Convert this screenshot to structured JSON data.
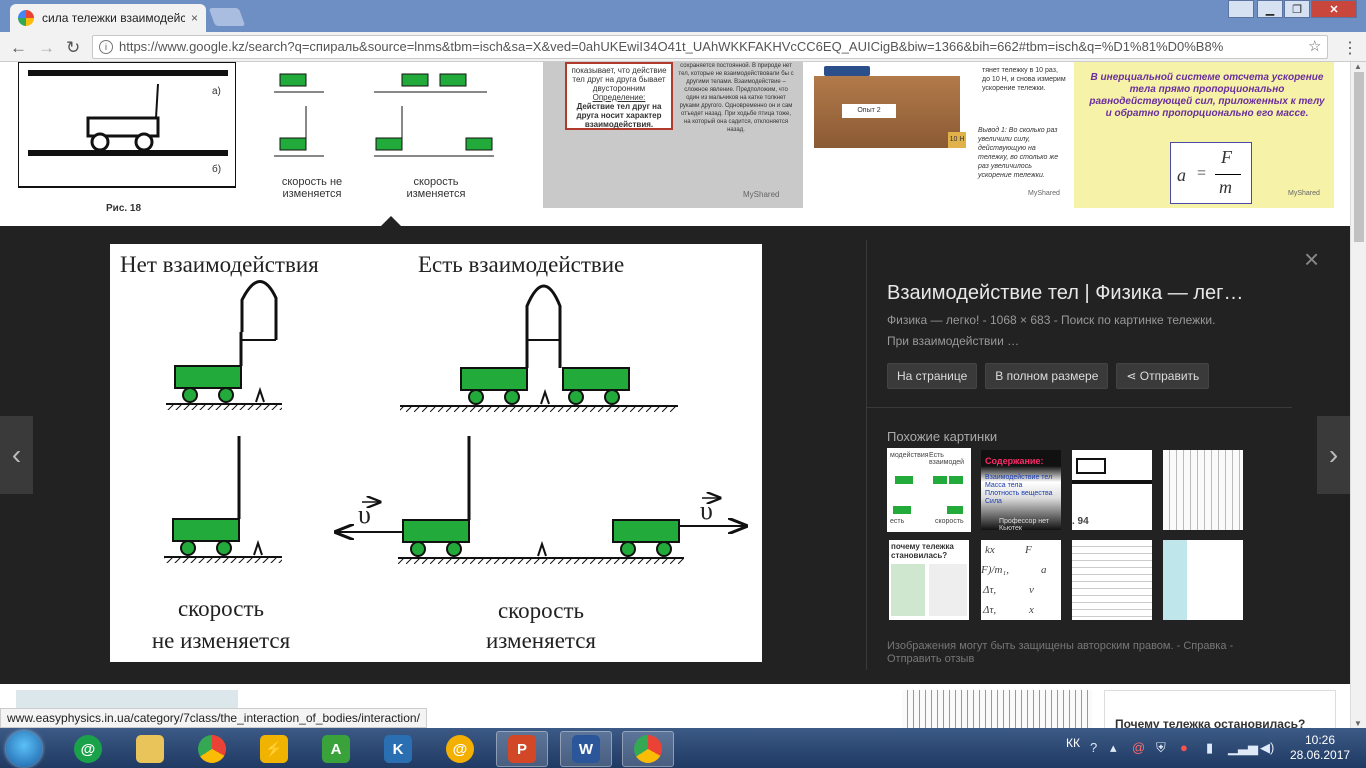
{
  "browser": {
    "tab_title": "сила тележки взаимодейс",
    "tab_close": "×",
    "url": "https://www.google.kz/search?q=спираль&source=lnms&tbm=isch&sa=X&ved=0ahUKEwiI34O41t_UAhWKKFAKHVcCC6EQ_AUICigB&biw=1366&bih=662#tbm=isch&q=%D1%81%D0%B8%",
    "status_url": "www.easyphysics.in.ua/category/7class/the_interaction_of_bodies/interaction/"
  },
  "thumbs_top": {
    "fig_label_a": "а)",
    "fig_label_b": "б)",
    "fig_caption": "Рис. 18",
    "t2_left_caption": "скорость не изменяется",
    "t2_right_caption": "скорость изменяется",
    "t3_text_1": "показывает, что действие тел друг на друга бывает двусторонним",
    "t3_definition": "Определение:",
    "t3_text_2": "Действие тел друг на друга носит характер взаимодействия.",
    "t3_right_1": "сохраняется постоянной. В природе нет тел, которые не взаимодействовали бы с другими телами.",
    "t3_right_2": "Взаимодействие – сложное явление. Предположим, что один из мальчиков на катке толкнет руками другого. Одновременно он и сам отъедет назад.",
    "t3_right_3": "При ходьбе птица тоже, на который она садится, отклоняется назад.",
    "watermark": "MyShared",
    "t4_box": "Опыт 2",
    "t4_weight": "10 Н",
    "t4_text": "тянет тележку в 10 раз, до 10 Н, и снова измерим ускорение тележки.",
    "t4_conclusion": "Вывод 1: Во сколько раз увеличили силу, действующую на тележку, во столько же раз увеличилось ускорение тележки.",
    "t5_text": "В инерциальной системе отсчета ускорение тела прямо пропорционально равнодействующей сил, приложенных к телу и обратно пропорционально его массе.",
    "t5_formula_a": "a",
    "t5_formula_eq": "=",
    "t5_formula_f": "F",
    "t5_formula_m": "m"
  },
  "viewer": {
    "img_no_interaction": "Нет взаимодействия",
    "img_interaction": "Есть взаимодействие",
    "img_velocity": "υ",
    "img_speed_1": "скорость",
    "img_speed_not_changes": "не изменяется",
    "img_speed_2": "скорость",
    "img_speed_changes": "изменяется",
    "title": "Взаимодействие тел | Физика — лег…",
    "meta": "Физика — легко! - 1068 × 683 - Поиск по картинке тележки. При взаимодействии …",
    "btn_page": "На странице",
    "btn_full": "В полном размере",
    "btn_share": "Отправить",
    "similar_heading": "Похожие картинки",
    "copyright": "Изображения могут быть защищены авторским правом.",
    "help": "Справка",
    "feedback": "Отправить отзыв",
    "close": "×",
    "prev": "‹",
    "next": "›"
  },
  "similar": {
    "s1_a": "модействия",
    "s1_b": "Есть взаимодей",
    "s1_c": "есть",
    "s1_d": "скорость",
    "s2_title": "Содержание:",
    "s2_lines": [
      "Взаимодействие тел",
      "Масса тела",
      "Плотность вещества",
      "Сила"
    ],
    "s2_footer": "Профессор нет Кьютек",
    "s3_num": ". 94",
    "s5_title": "почему тележка становилась?",
    "s6_l1": "kx",
    "s6_l2": "F",
    "s6_l3": "F)/m₁,",
    "s6_l4": "a",
    "s6_l5": "Δτ,",
    "s6_l6": "v",
    "s6_l7": "Δτ,",
    "s6_l8": "x"
  },
  "below": {
    "card_title": "Почему тележка остановилась?"
  },
  "taskbar": {
    "lang": "КК",
    "time": "10:26",
    "date": "28.06.2017"
  },
  "colors": {
    "cart_green": "#22aa3a",
    "viewer_bg": "#222222",
    "titlebar": "#6e8fc4"
  }
}
